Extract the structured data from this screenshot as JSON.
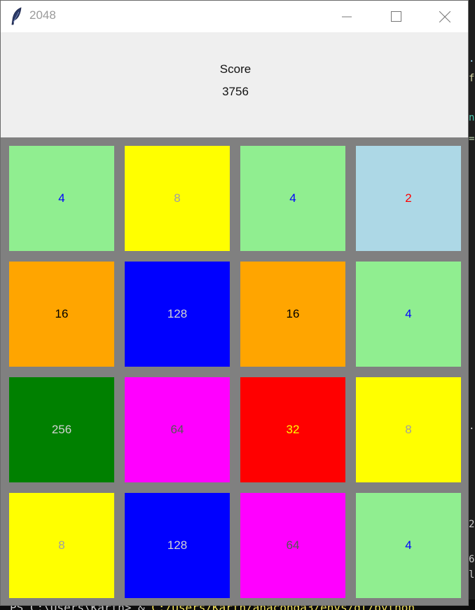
{
  "window": {
    "title": "2048",
    "icons": {
      "app": "feather-icon",
      "minimize": "minimize-icon",
      "maximize": "maximize-icon",
      "close": "close-icon"
    }
  },
  "score": {
    "label": "Score",
    "value": "3756"
  },
  "board": {
    "rows": [
      [
        {
          "value": "4",
          "bg": "#90ee90",
          "fg": "#0000ff"
        },
        {
          "value": "8",
          "bg": "#ffff00",
          "fg": "#a0a0a0"
        },
        {
          "value": "4",
          "bg": "#90ee90",
          "fg": "#0000ff"
        },
        {
          "value": "2",
          "bg": "#add8e6",
          "fg": "#ff0000"
        }
      ],
      [
        {
          "value": "16",
          "bg": "#ffa500",
          "fg": "#000000"
        },
        {
          "value": "128",
          "bg": "#0000ff",
          "fg": "#d3d3d3"
        },
        {
          "value": "16",
          "bg": "#ffa500",
          "fg": "#000000"
        },
        {
          "value": "4",
          "bg": "#90ee90",
          "fg": "#0000ff"
        }
      ],
      [
        {
          "value": "256",
          "bg": "#008000",
          "fg": "#d3d3d3"
        },
        {
          "value": "64",
          "bg": "#ff00ff",
          "fg": "#555555"
        },
        {
          "value": "32",
          "bg": "#ff0000",
          "fg": "#ffff00"
        },
        {
          "value": "8",
          "bg": "#ffff00",
          "fg": "#a0a0a0"
        }
      ],
      [
        {
          "value": "8",
          "bg": "#ffff00",
          "fg": "#a0a0a0"
        },
        {
          "value": "128",
          "bg": "#0000ff",
          "fg": "#d3d3d3"
        },
        {
          "value": "64",
          "bg": "#ff00ff",
          "fg": "#555555"
        },
        {
          "value": "4",
          "bg": "#90ee90",
          "fg": "#0000ff"
        }
      ]
    ]
  },
  "background": {
    "terminal_prefix": "PS C:\\Users\\Karth> & ",
    "terminal_path": "C:/Users/Karth/anaconda3/envs/dl/python"
  }
}
